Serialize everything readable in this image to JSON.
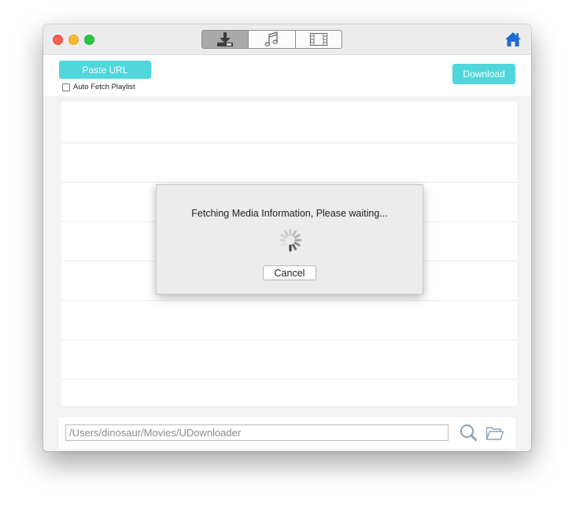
{
  "toolbar": {
    "tabs": [
      {
        "name": "download-tab-icon",
        "active": true
      },
      {
        "name": "music-tab-icon",
        "active": false
      },
      {
        "name": "video-tab-icon",
        "active": false
      }
    ],
    "paste_url_label": "Paste URL",
    "auto_fetch_label": "Auto Fetch Playlist",
    "auto_fetch_checked": false,
    "download_label": "Download"
  },
  "dialog": {
    "message": "Fetching Media Information, Please waiting...",
    "cancel_label": "Cancel"
  },
  "footer": {
    "save_path": "/Users/dinosaur/Movies/UDownloader"
  },
  "colors": {
    "accent": "#4fd7dc",
    "home_icon": "#1f6bd6"
  }
}
